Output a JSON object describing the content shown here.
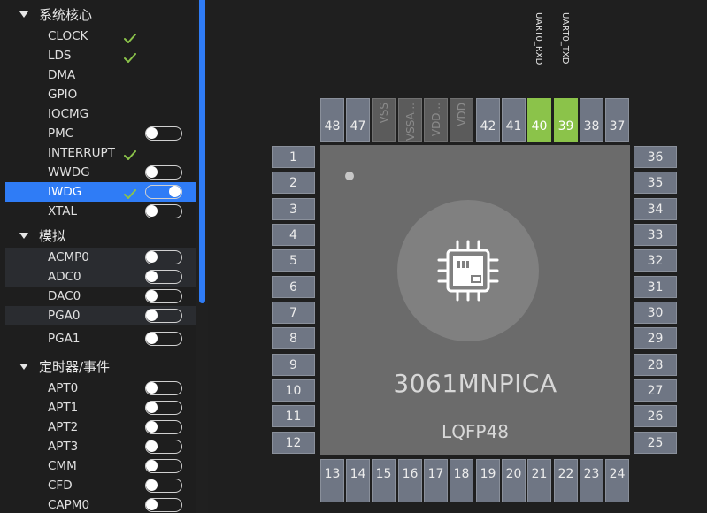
{
  "sidebar": {
    "groups": [
      {
        "title": "系统核心",
        "items": [
          {
            "label": "CLOCK",
            "check": true,
            "toggle": null,
            "state": "normal"
          },
          {
            "label": "LDS",
            "check": true,
            "toggle": null,
            "state": "normal"
          },
          {
            "label": "DMA",
            "check": false,
            "toggle": null,
            "state": "normal"
          },
          {
            "label": "GPIO",
            "check": false,
            "toggle": null,
            "state": "normal"
          },
          {
            "label": "IOCMG",
            "check": false,
            "toggle": null,
            "state": "normal"
          },
          {
            "label": "PMC",
            "check": false,
            "toggle": "off",
            "state": "normal"
          },
          {
            "label": "INTERRUPT",
            "check": true,
            "toggle": null,
            "state": "normal"
          },
          {
            "label": "WWDG",
            "check": false,
            "toggle": "off",
            "state": "normal"
          },
          {
            "label": "IWDG",
            "check": true,
            "toggle": "on",
            "state": "selected"
          },
          {
            "label": "XTAL",
            "check": false,
            "toggle": "off",
            "state": "normal"
          }
        ]
      },
      {
        "title": "模拟",
        "items": [
          {
            "label": "ACMP0",
            "check": false,
            "toggle": "off",
            "state": "shaded"
          },
          {
            "label": "ADC0",
            "check": false,
            "toggle": "off",
            "state": "shaded"
          },
          {
            "label": "DAC0",
            "check": false,
            "toggle": "off",
            "state": "normal"
          },
          {
            "label": "PGA0",
            "check": false,
            "toggle": "off",
            "state": "shaded"
          },
          {
            "label": "PGA1",
            "check": false,
            "toggle": "off",
            "state": "normal"
          }
        ]
      },
      {
        "title": "定时器/事件",
        "items": [
          {
            "label": "APT0",
            "check": false,
            "toggle": "off",
            "state": "normal"
          },
          {
            "label": "APT1",
            "check": false,
            "toggle": "off",
            "state": "normal"
          },
          {
            "label": "APT2",
            "check": false,
            "toggle": "off",
            "state": "normal"
          },
          {
            "label": "APT3",
            "check": false,
            "toggle": "off",
            "state": "normal"
          },
          {
            "label": "CMM",
            "check": false,
            "toggle": "off",
            "state": "normal"
          },
          {
            "label": "CFD",
            "check": false,
            "toggle": "off",
            "state": "normal"
          },
          {
            "label": "CAPM0",
            "check": false,
            "toggle": "off",
            "state": "normal"
          }
        ]
      }
    ]
  },
  "chip": {
    "name": "3061MNPICA",
    "package": "LQFP48",
    "pins_left": [
      "1",
      "2",
      "3",
      "4",
      "5",
      "6",
      "7",
      "8",
      "9",
      "10",
      "11",
      "12"
    ],
    "pins_right": [
      "36",
      "35",
      "34",
      "33",
      "32",
      "31",
      "30",
      "29",
      "28",
      "27",
      "26",
      "25"
    ],
    "pins_bottom": [
      "13",
      "14",
      "15",
      "16",
      "17",
      "18",
      "19",
      "20",
      "21",
      "22",
      "23",
      "24"
    ],
    "pins_top": [
      {
        "label": "48",
        "type": "normal"
      },
      {
        "label": "47",
        "type": "normal"
      },
      {
        "label": "VSS",
        "type": "power"
      },
      {
        "label": "VSSA...",
        "type": "power"
      },
      {
        "label": "VDD...",
        "type": "power"
      },
      {
        "label": "VDD",
        "type": "power"
      },
      {
        "label": "42",
        "type": "normal"
      },
      {
        "label": "41",
        "type": "normal"
      },
      {
        "label": "40",
        "type": "assigned",
        "signal": "UART0_RXD"
      },
      {
        "label": "39",
        "type": "assigned",
        "signal": "UART0_TXD"
      },
      {
        "label": "38",
        "type": "normal"
      },
      {
        "label": "37",
        "type": "normal"
      }
    ]
  },
  "colors": {
    "accent": "#2f7cf6",
    "assigned": "#8bc34a",
    "check": "#8bc34a",
    "pin": "#6f7684"
  },
  "icons": {
    "chip": "chip-icon",
    "check": "check-icon",
    "caret": "caret-down-icon"
  }
}
